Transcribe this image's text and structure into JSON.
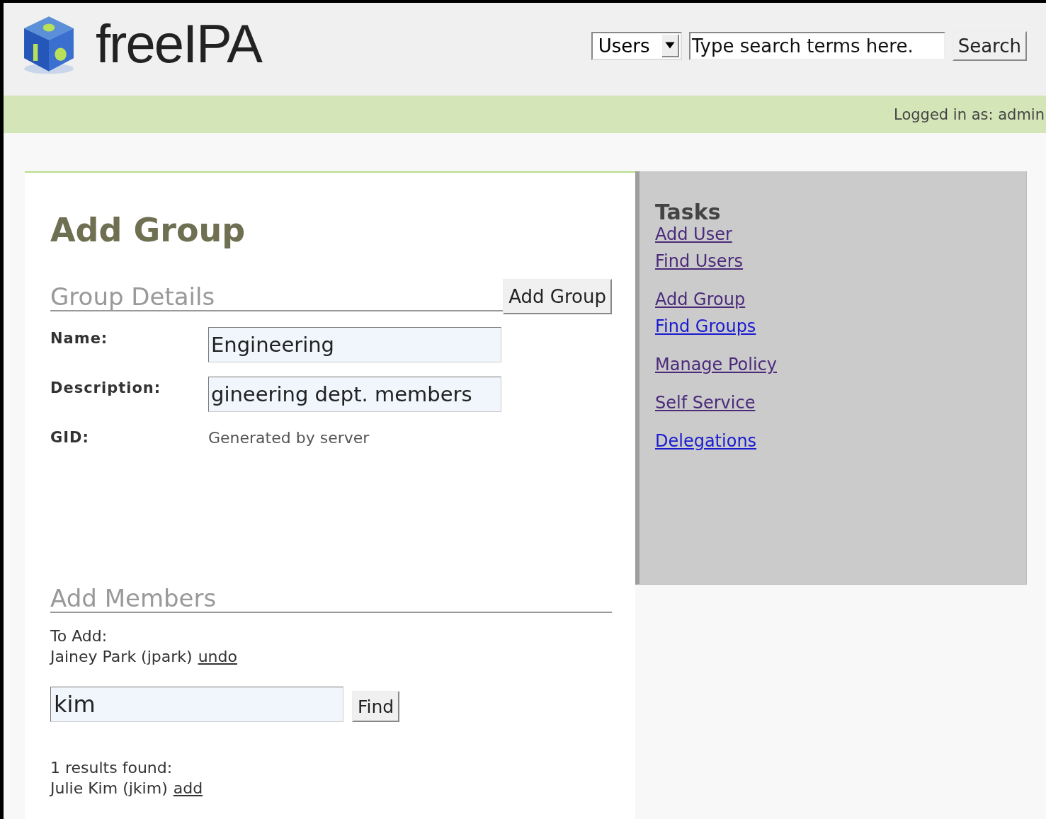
{
  "header": {
    "logo_text": "freeIPA",
    "search_scope": "Users",
    "search": {
      "placeholder": "Type search terms here."
    },
    "search_button": "Search"
  },
  "status_bar": {
    "logged_in": "Logged in as: admin"
  },
  "main": {
    "title": "Add Group",
    "group_details": {
      "heading": "Group Details",
      "submit_button": "Add Group",
      "fields": [
        {
          "kind": "input",
          "label": "Name:",
          "value": "Engineering"
        },
        {
          "kind": "input",
          "label": "Description:",
          "value": "gineering dept. members"
        },
        {
          "kind": "text",
          "label": "GID:",
          "value": "Generated by server"
        }
      ]
    },
    "add_members": {
      "heading": "Add Members",
      "to_add_label": "To Add:",
      "to_add": [
        {
          "name": "Jainey Park (jpark)",
          "action": "undo"
        }
      ],
      "find": {
        "value": "kim",
        "button": "Find"
      },
      "results_label": "1 results found:",
      "results": [
        {
          "name": "Julie Kim (jkim)",
          "action": "add"
        }
      ]
    }
  },
  "sidebar": {
    "title": "Tasks",
    "groups": [
      [
        {
          "label": "Add User",
          "visited": true
        },
        {
          "label": "Find Users",
          "visited": true
        }
      ],
      [
        {
          "label": "Add Group",
          "visited": true
        },
        {
          "label": "Find Groups",
          "visited": false
        }
      ],
      [
        {
          "label": "Manage Policy",
          "visited": true
        }
      ],
      [
        {
          "label": "Self Service",
          "visited": true
        }
      ],
      [
        {
          "label": "Delegations",
          "visited": false
        }
      ]
    ]
  }
}
